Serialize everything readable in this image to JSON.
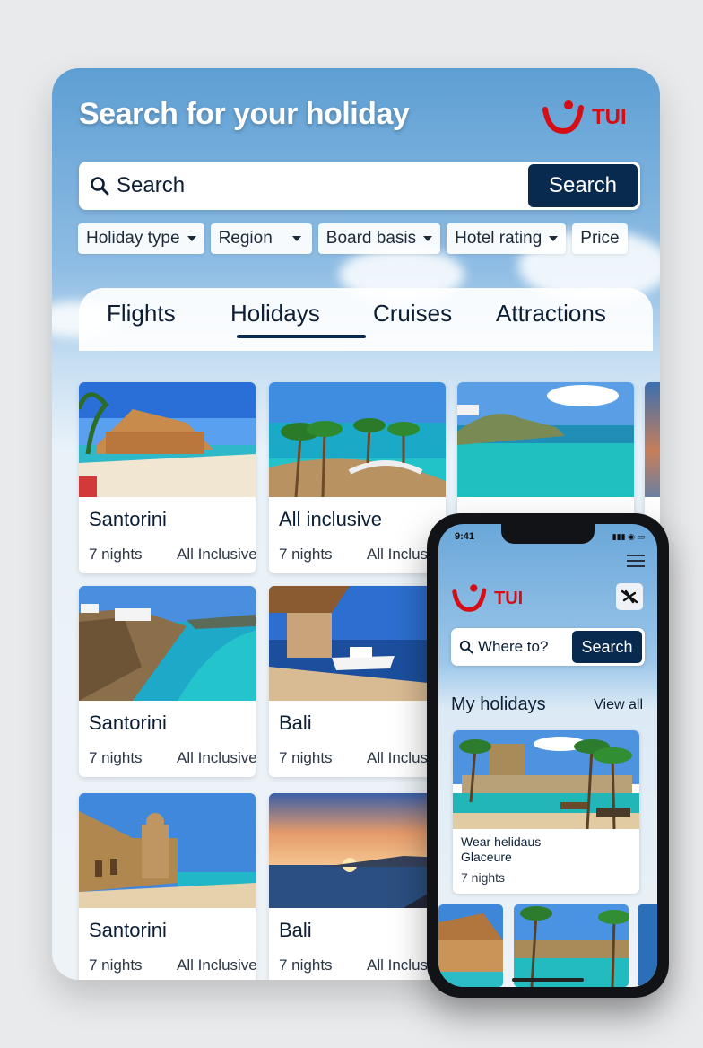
{
  "tablet": {
    "title": "Search for your holiday",
    "logo_text": "TUI",
    "search": {
      "placeholder": "Search",
      "button": "Search"
    },
    "filters": [
      {
        "label": "Holiday type",
        "has_caret": true
      },
      {
        "label": "Region",
        "has_caret": true
      },
      {
        "label": "Board basis",
        "has_caret": true
      },
      {
        "label": "Hotel rating",
        "has_caret": true
      },
      {
        "label": "Price",
        "has_caret": false
      }
    ],
    "tabs": [
      {
        "label": "Flights",
        "active": false
      },
      {
        "label": "Holidays",
        "active": true
      },
      {
        "label": "Cruises",
        "active": false
      },
      {
        "label": "Attractions",
        "active": false
      }
    ],
    "cards": [
      {
        "title": "Santorini",
        "nights": "7 nights",
        "board": "All Inclusive"
      },
      {
        "title": "All inclusive",
        "nights": "7 nights",
        "board": "All Inclusive"
      },
      {
        "title": "",
        "nights": "",
        "board": ""
      },
      {
        "title": "Santorini",
        "nights": "7 nights",
        "board": "All Inclusive"
      },
      {
        "title": "Bali",
        "nights": "7 nights",
        "board": "All Inclusive"
      },
      {
        "title": "Santorini",
        "nights": "7 nights",
        "board": "All Inclusive"
      },
      {
        "title": "Bali",
        "nights": "7 nights",
        "board": "All Inclusive"
      }
    ]
  },
  "phone": {
    "status_time": "9:41",
    "logo_text": "TUI",
    "search": {
      "placeholder": "Where to?",
      "button": "Search"
    },
    "section_title": "My holidays",
    "view_all": "View all",
    "card": {
      "title_line1": "Wear helidaus",
      "title_line2": "Glaceure",
      "nights": "7 nights"
    }
  },
  "colors": {
    "brand_red": "#d40e14",
    "navy": "#092a4f",
    "sky": "#5e9fd3"
  },
  "icons": [
    "search-icon",
    "chevron-down-icon",
    "tui-smile-logo-icon",
    "menu-icon",
    "airplane-icon"
  ]
}
